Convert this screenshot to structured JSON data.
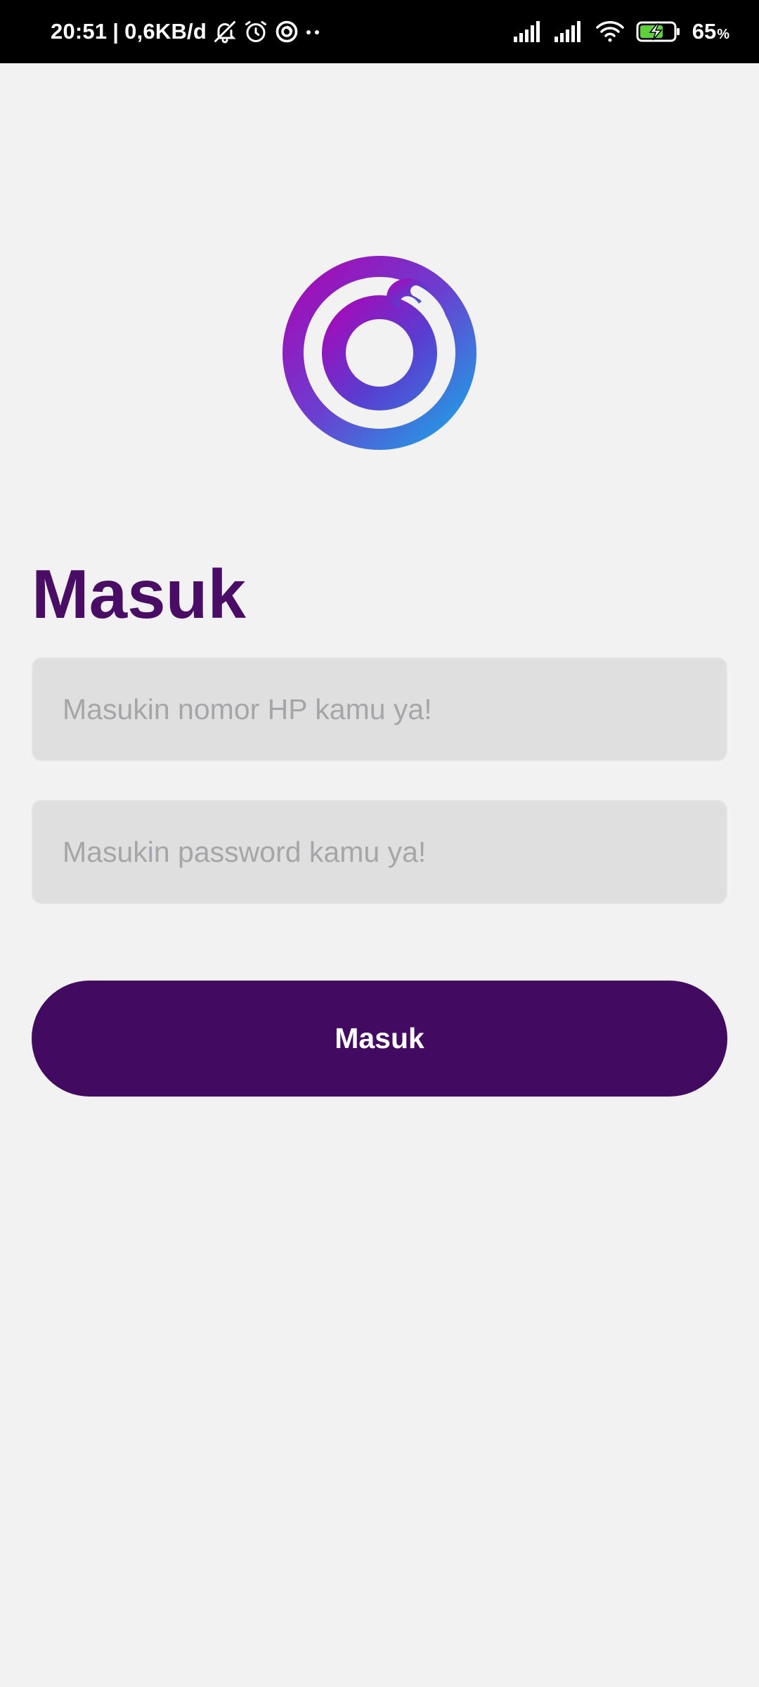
{
  "status_bar": {
    "time": "20:51",
    "separator": "|",
    "network_speed": "0,6KB/d",
    "battery_level": "65",
    "battery_unit": "%",
    "icons": [
      "bell-off-icon",
      "alarm-icon",
      "ring-icon",
      "more-dots-icon",
      "signal-icon",
      "signal-icon",
      "wifi-icon",
      "battery-charging-icon"
    ]
  },
  "logo": {
    "colors": [
      "#b000b0",
      "#6a3fd0",
      "#10b0e8"
    ]
  },
  "login": {
    "title": "Masuk",
    "phone_placeholder": "Masukin nomor HP kamu ya!",
    "phone_value": "",
    "password_placeholder": "Masukin password kamu ya!",
    "password_value": "",
    "submit_label": "Masuk"
  },
  "colors": {
    "background": "#f2f2f2",
    "primary": "#430a61",
    "title": "#4a0d66",
    "input_bg": "#e0dfe0",
    "placeholder": "#a6a5a7"
  }
}
